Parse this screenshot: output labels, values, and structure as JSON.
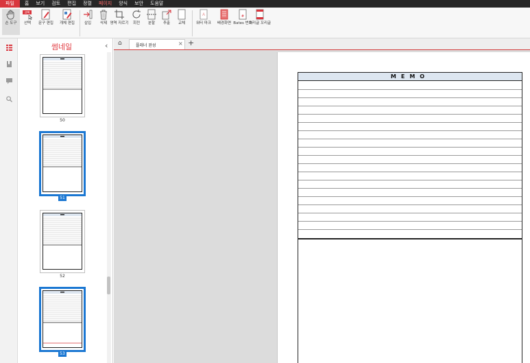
{
  "menu": {
    "items": [
      "파일",
      "홈",
      "보기",
      "검토",
      "편집",
      "정렬",
      "페이지",
      "양식",
      "보안",
      "도움말"
    ],
    "active": "페이지"
  },
  "ribbon": {
    "buttons": [
      {
        "label": "손 도구",
        "icon": "hand-icon"
      },
      {
        "label": "선택",
        "icon": "select-icon"
      },
      {
        "label": "문구 편집",
        "icon": "edit-text-icon"
      },
      {
        "label": "개체 편집",
        "icon": "edit-object-icon"
      },
      {
        "label": "삽입",
        "icon": "insert-page-icon"
      },
      {
        "label": "삭제",
        "icon": "delete-page-icon"
      },
      {
        "label": "영역 자르기",
        "icon": "crop-icon"
      },
      {
        "label": "회전",
        "icon": "rotate-icon"
      },
      {
        "label": "분할",
        "icon": "split-icon"
      },
      {
        "label": "추출",
        "icon": "extract-icon"
      },
      {
        "label": "교체",
        "icon": "replace-icon"
      },
      {
        "label": "워터 마크",
        "icon": "watermark-icon"
      },
      {
        "label": "배경화면",
        "icon": "background-icon"
      },
      {
        "label": "Bates 번호",
        "icon": "bates-number-icon"
      },
      {
        "label": "머리글 꼬리글",
        "icon": "header-footer-icon"
      }
    ]
  },
  "thumbnails": {
    "title": "썸네일",
    "pages": [
      {
        "number": "50",
        "selected": false
      },
      {
        "number": "51",
        "selected": true
      },
      {
        "number": "52",
        "selected": false
      },
      {
        "number": "53",
        "selected": true
      }
    ]
  },
  "tabs": {
    "active_tab": "플래너 완성"
  },
  "document": {
    "memo_title": "MEMO"
  },
  "colors": {
    "accent": "#d9363e",
    "selection": "#1b77d2",
    "menubar": "#262626",
    "memo_header": "#dde6f0"
  }
}
